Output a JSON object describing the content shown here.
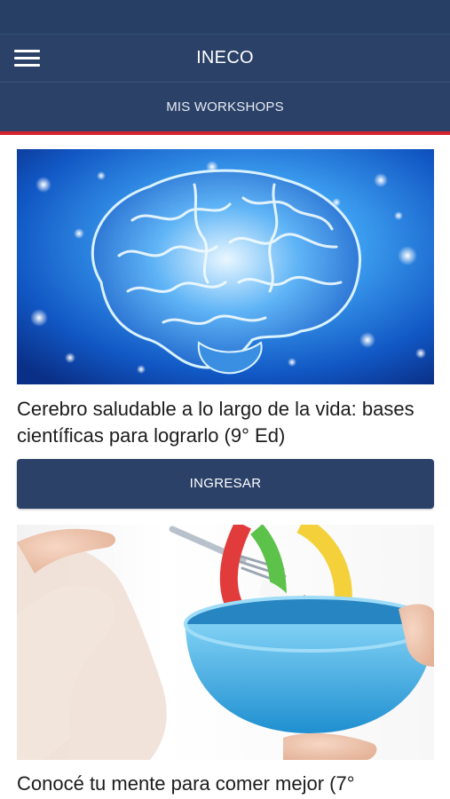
{
  "colors": {
    "header": "#2b4168",
    "status_bar": "#273f64",
    "accent_red": "#d5232f",
    "button": "#2b4168"
  },
  "app_bar": {
    "title": "INECO",
    "menu_icon": "hamburger-menu-icon"
  },
  "tabs": [
    {
      "label": "MIS WORKSHOPS",
      "selected": true
    }
  ],
  "workshops": [
    {
      "image": "brain-image",
      "title": "Cerebro saludable a lo largo de la vida: bases científicas para lograrlo (9° Ed)",
      "button_label": "INGRESAR"
    },
    {
      "image": "bowl-with-measuring-tape-image",
      "title": "Conocé tu mente para comer mejor (7°"
    }
  ]
}
